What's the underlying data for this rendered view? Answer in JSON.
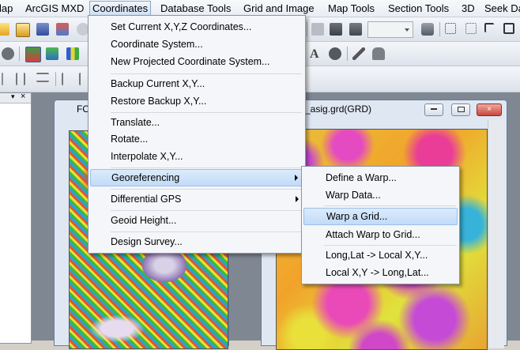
{
  "menubar": {
    "items": [
      "lap",
      "ArcGIS MXD",
      "Coordinates",
      "Database Tools",
      "Grid and Image",
      "Map Tools",
      "Section Tools",
      "3D",
      "Seek Dat"
    ]
  },
  "coordinates_menu": {
    "items": [
      {
        "label": "Set Current X,Y,Z Coordinates..."
      },
      {
        "label": "Coordinate System..."
      },
      {
        "label": "New Projected Coordinate System..."
      },
      {
        "label": "Backup Current X,Y..."
      },
      {
        "label": "Restore Backup X,Y..."
      },
      {
        "label": "Translate..."
      },
      {
        "label": "Rotate..."
      },
      {
        "label": "Interpolate X,Y..."
      },
      {
        "label": "Georeferencing"
      },
      {
        "label": "Differential GPS"
      },
      {
        "label": "Geoid Height..."
      },
      {
        "label": "Design Survey..."
      }
    ]
  },
  "georef_menu": {
    "items": [
      {
        "label": "Define a Warp..."
      },
      {
        "label": "Warp Data..."
      },
      {
        "label": "Warp a Grid..."
      },
      {
        "label": "Attach Warp to Grid..."
      },
      {
        "label": "Long,Lat -> Local X,Y..."
      },
      {
        "label": "Local X,Y -> Long,Lat..."
      }
    ]
  },
  "windows": {
    "left_title": "FO",
    "right_title": "_asig.grd(GRD)"
  },
  "panel": {
    "close_label": "×",
    "pin_label": "▾"
  },
  "icons": {
    "font_icon": "A"
  }
}
